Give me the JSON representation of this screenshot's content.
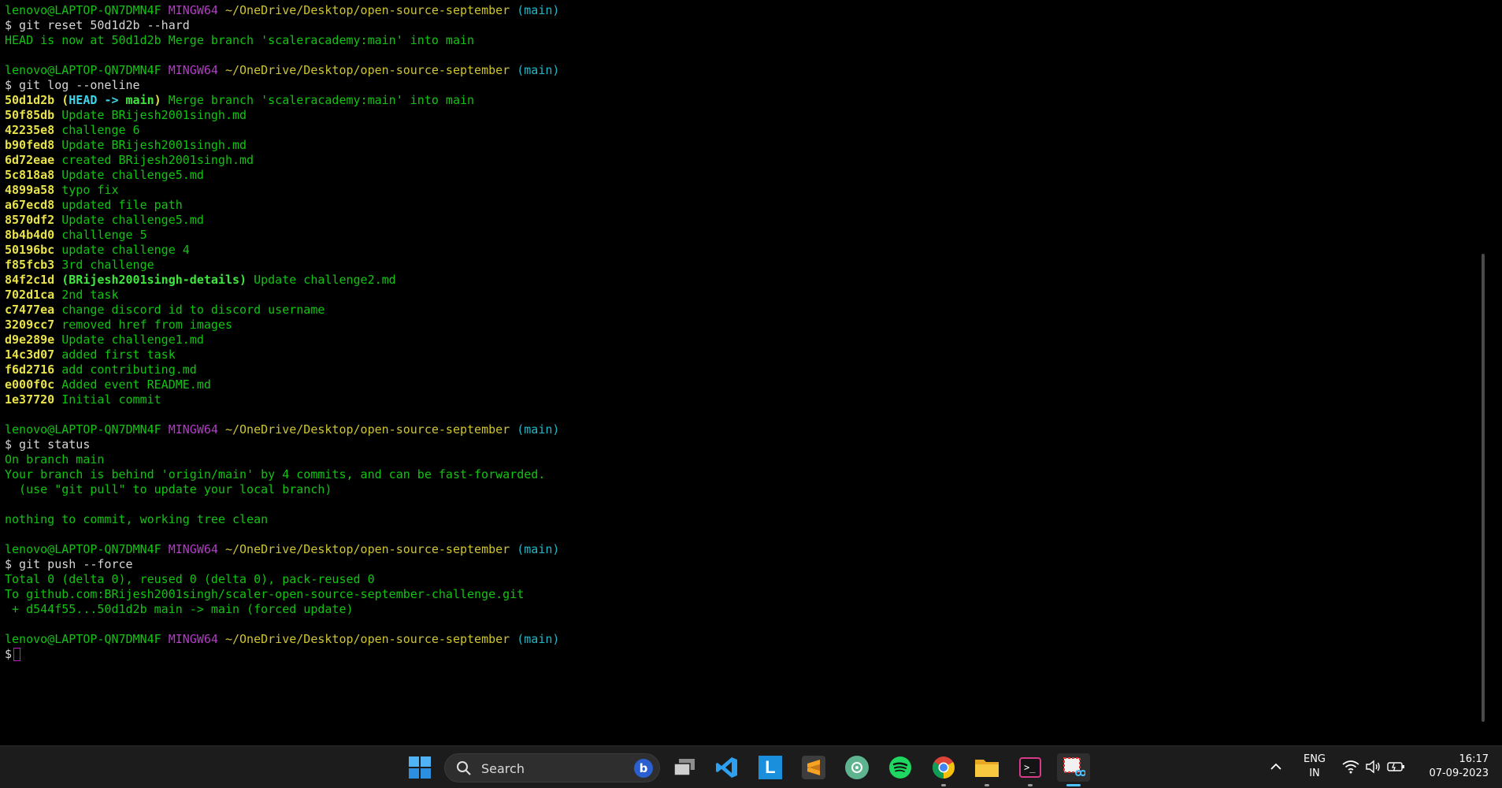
{
  "terminal": {
    "prompt": {
      "user_host": "lenovo@LAPTOP-QN7DMN4F",
      "env": "MINGW64",
      "path": "~/OneDrive/Desktop/open-source-september",
      "branch": "(main)"
    },
    "blocks": [
      {
        "command": "$ git reset 50d1d2b --hard",
        "output": [
          "HEAD is now at 50d1d2b Merge branch 'scaleracademy:main' into main"
        ]
      },
      {
        "command": "$ git log --oneline",
        "log": [
          {
            "hash": "50d1d2b",
            "deco_open": "(",
            "deco_head": "HEAD -> ",
            "deco_branch": "main",
            "deco_close": ")",
            "message": "Merge branch 'scaleracademy:main' into main"
          },
          {
            "hash": "50f85db",
            "message": "Update BRijesh2001singh.md"
          },
          {
            "hash": "42235e8",
            "message": "challenge 6"
          },
          {
            "hash": "b90fed8",
            "message": "Update BRijesh2001singh.md"
          },
          {
            "hash": "6d72eae",
            "message": "created BRijesh2001singh.md"
          },
          {
            "hash": "5c818a8",
            "message": "Update challenge5.md"
          },
          {
            "hash": "4899a58",
            "message": "typo fix"
          },
          {
            "hash": "a67ecd8",
            "message": "updated file path"
          },
          {
            "hash": "8570df2",
            "message": "Update challenge5.md"
          },
          {
            "hash": "8b4b4d0",
            "message": "challlenge 5"
          },
          {
            "hash": "50196bc",
            "message": "update challenge 4"
          },
          {
            "hash": "f85fcb3",
            "message": "3rd challenge"
          },
          {
            "hash": "84f2c1d",
            "deco_branch_only": "(BRijesh2001singh-details)",
            "message": "Update challenge2.md"
          },
          {
            "hash": "702d1ca",
            "message": "2nd task"
          },
          {
            "hash": "c7477ea",
            "message": "change discord id to discord username"
          },
          {
            "hash": "3209cc7",
            "message": "removed href from images"
          },
          {
            "hash": "d9e289e",
            "message": "Update challenge1.md"
          },
          {
            "hash": "14c3d07",
            "message": "added first task"
          },
          {
            "hash": "f6d2716",
            "message": "add contributing.md"
          },
          {
            "hash": "e000f0c",
            "message": "Added event README.md"
          },
          {
            "hash": "1e37720",
            "message": "Initial commit"
          }
        ]
      },
      {
        "command": "$ git status",
        "output": [
          "On branch main",
          "Your branch is behind 'origin/main' by 4 commits, and can be fast-forwarded.",
          "  (use \"git pull\" to update your local branch)",
          "",
          "nothing to commit, working tree clean"
        ]
      },
      {
        "command": "$ git push --force",
        "output": [
          "Total 0 (delta 0), reused 0 (delta 0), pack-reused 0",
          "To github.com:BRijesh2001singh/scaler-open-source-september-challenge.git",
          " + d544f55...50d1d2b main -> main (forced update)"
        ]
      }
    ],
    "final_prompt_symbol": "$"
  },
  "taskbar": {
    "search_label": "Search",
    "apps": [
      "windows-start-icon",
      "task-view-icon",
      "vscode-icon",
      "l-app-icon",
      "sublime-text-icon",
      "openai-icon",
      "spotify-icon",
      "chrome-icon",
      "file-explorer-icon",
      "terminal-app-icon",
      "snipping-tool-icon"
    ],
    "tray": {
      "lang_top": "ENG",
      "lang_bottom": "IN",
      "time": "16:17",
      "date": "07-09-2023"
    },
    "colors": {
      "taskbar_bg": "#1c1c1c",
      "accent": "#4cc2ff"
    }
  }
}
